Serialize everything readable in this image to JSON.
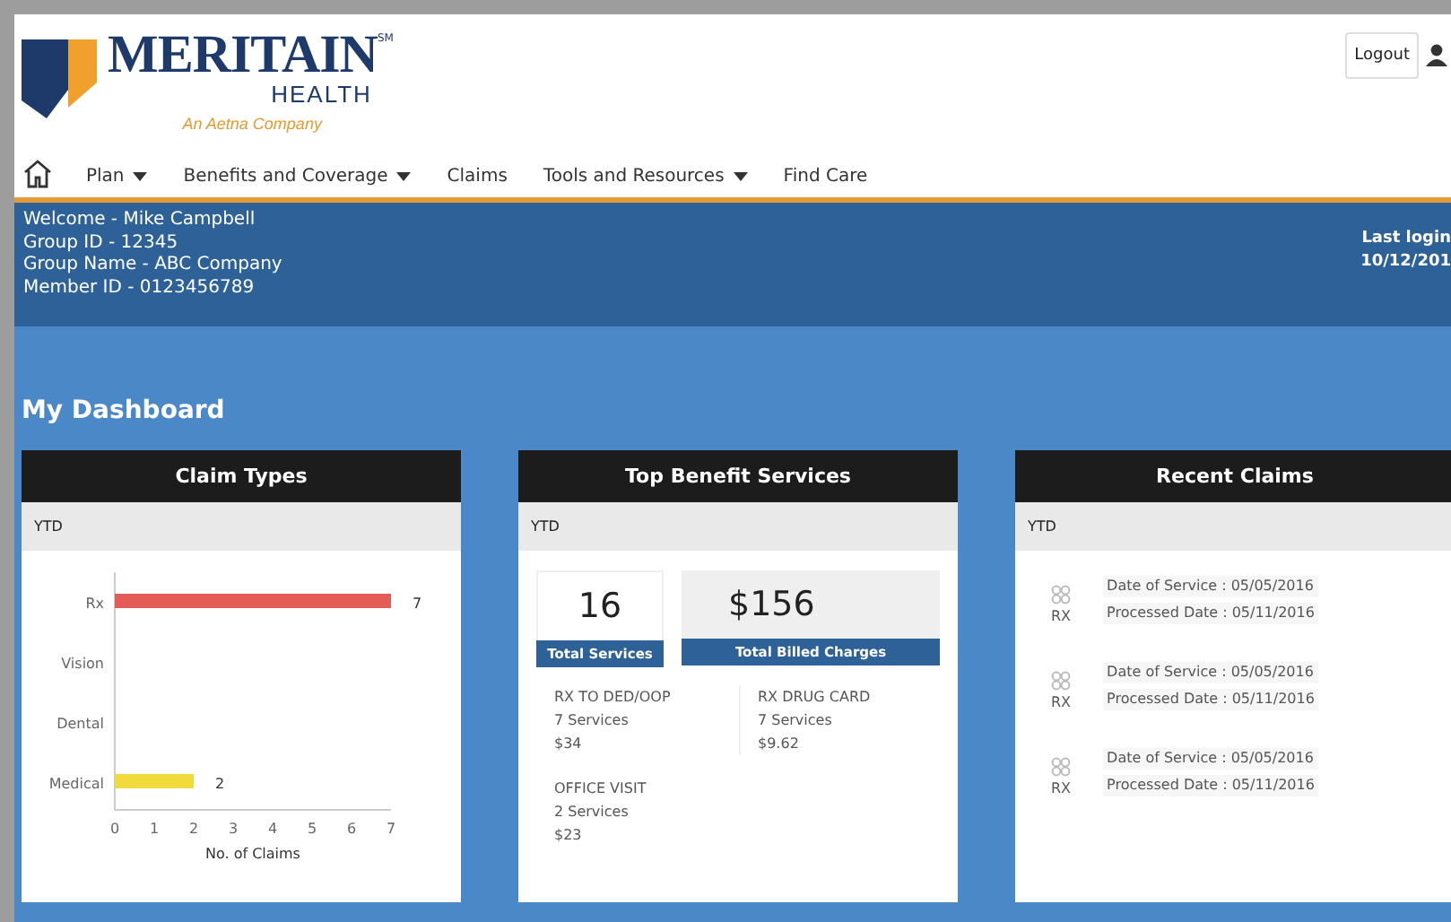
{
  "logo": {
    "name": "MERITAIN",
    "mark": "SM",
    "subname": "HEALTH",
    "tagline": "An Aetna Company"
  },
  "logout": "Logout",
  "nav": [
    {
      "label": "Plan",
      "dropdown": true
    },
    {
      "label": "Benefits and Coverage",
      "dropdown": true
    },
    {
      "label": "Claims",
      "dropdown": false
    },
    {
      "label": "Tools and Resources",
      "dropdown": true
    },
    {
      "label": "Find Care",
      "dropdown": false
    }
  ],
  "member": [
    "Welcome - Mike Campbell",
    "Group ID - 12345",
    "Group Name - ABC Company",
    "Member ID - 0123456789"
  ],
  "last_login": {
    "label": "Last login",
    "date": "10/12/201"
  },
  "dashboard_title": "My Dashboard",
  "claim_types": {
    "title": "Claim Types",
    "period": "YTD",
    "chart_data": {
      "type": "bar",
      "orientation": "horizontal",
      "xlabel": "No. of Claims",
      "categories": [
        "Rx",
        "Vision",
        "Dental",
        "Medical"
      ],
      "data_labels": true,
      "xlim": [
        0,
        7
      ],
      "xticks": [
        0,
        1,
        2,
        3,
        4,
        5,
        6,
        7
      ],
      "series": [
        {
          "color": "#e35c58",
          "values": [
            7,
            null,
            null,
            null
          ]
        },
        {
          "color": "#f1da3b",
          "values": [
            null,
            null,
            null,
            2
          ]
        }
      ]
    }
  },
  "top_benefits": {
    "title": "Top Benefit Services",
    "period": "YTD",
    "total_services": "16",
    "total_services_label": "Total Services",
    "total_charges": "$156",
    "total_charges_label": "Total Billed Charges",
    "services": [
      {
        "name": "RX TO DED/OOP",
        "count": "7 Services",
        "amount": "$34"
      },
      {
        "name": "RX DRUG CARD",
        "count": "7 Services",
        "amount": "$9.62"
      },
      {
        "name": "OFFICE VISIT",
        "count": "2 Services",
        "amount": "$23"
      }
    ]
  },
  "recent_claims": {
    "title": "Recent Claims",
    "period": "YTD",
    "claims": [
      {
        "type": "RX",
        "service_date": "Date of Service : 05/05/2016",
        "processed_date": "Processed Date : 05/11/2016"
      },
      {
        "type": "RX",
        "service_date": "Date of Service : 05/05/2016",
        "processed_date": "Processed Date : 05/11/2016"
      },
      {
        "type": "RX",
        "service_date": "Date of Service : 05/05/2016",
        "processed_date": "Processed Date : 05/11/2016"
      }
    ]
  }
}
